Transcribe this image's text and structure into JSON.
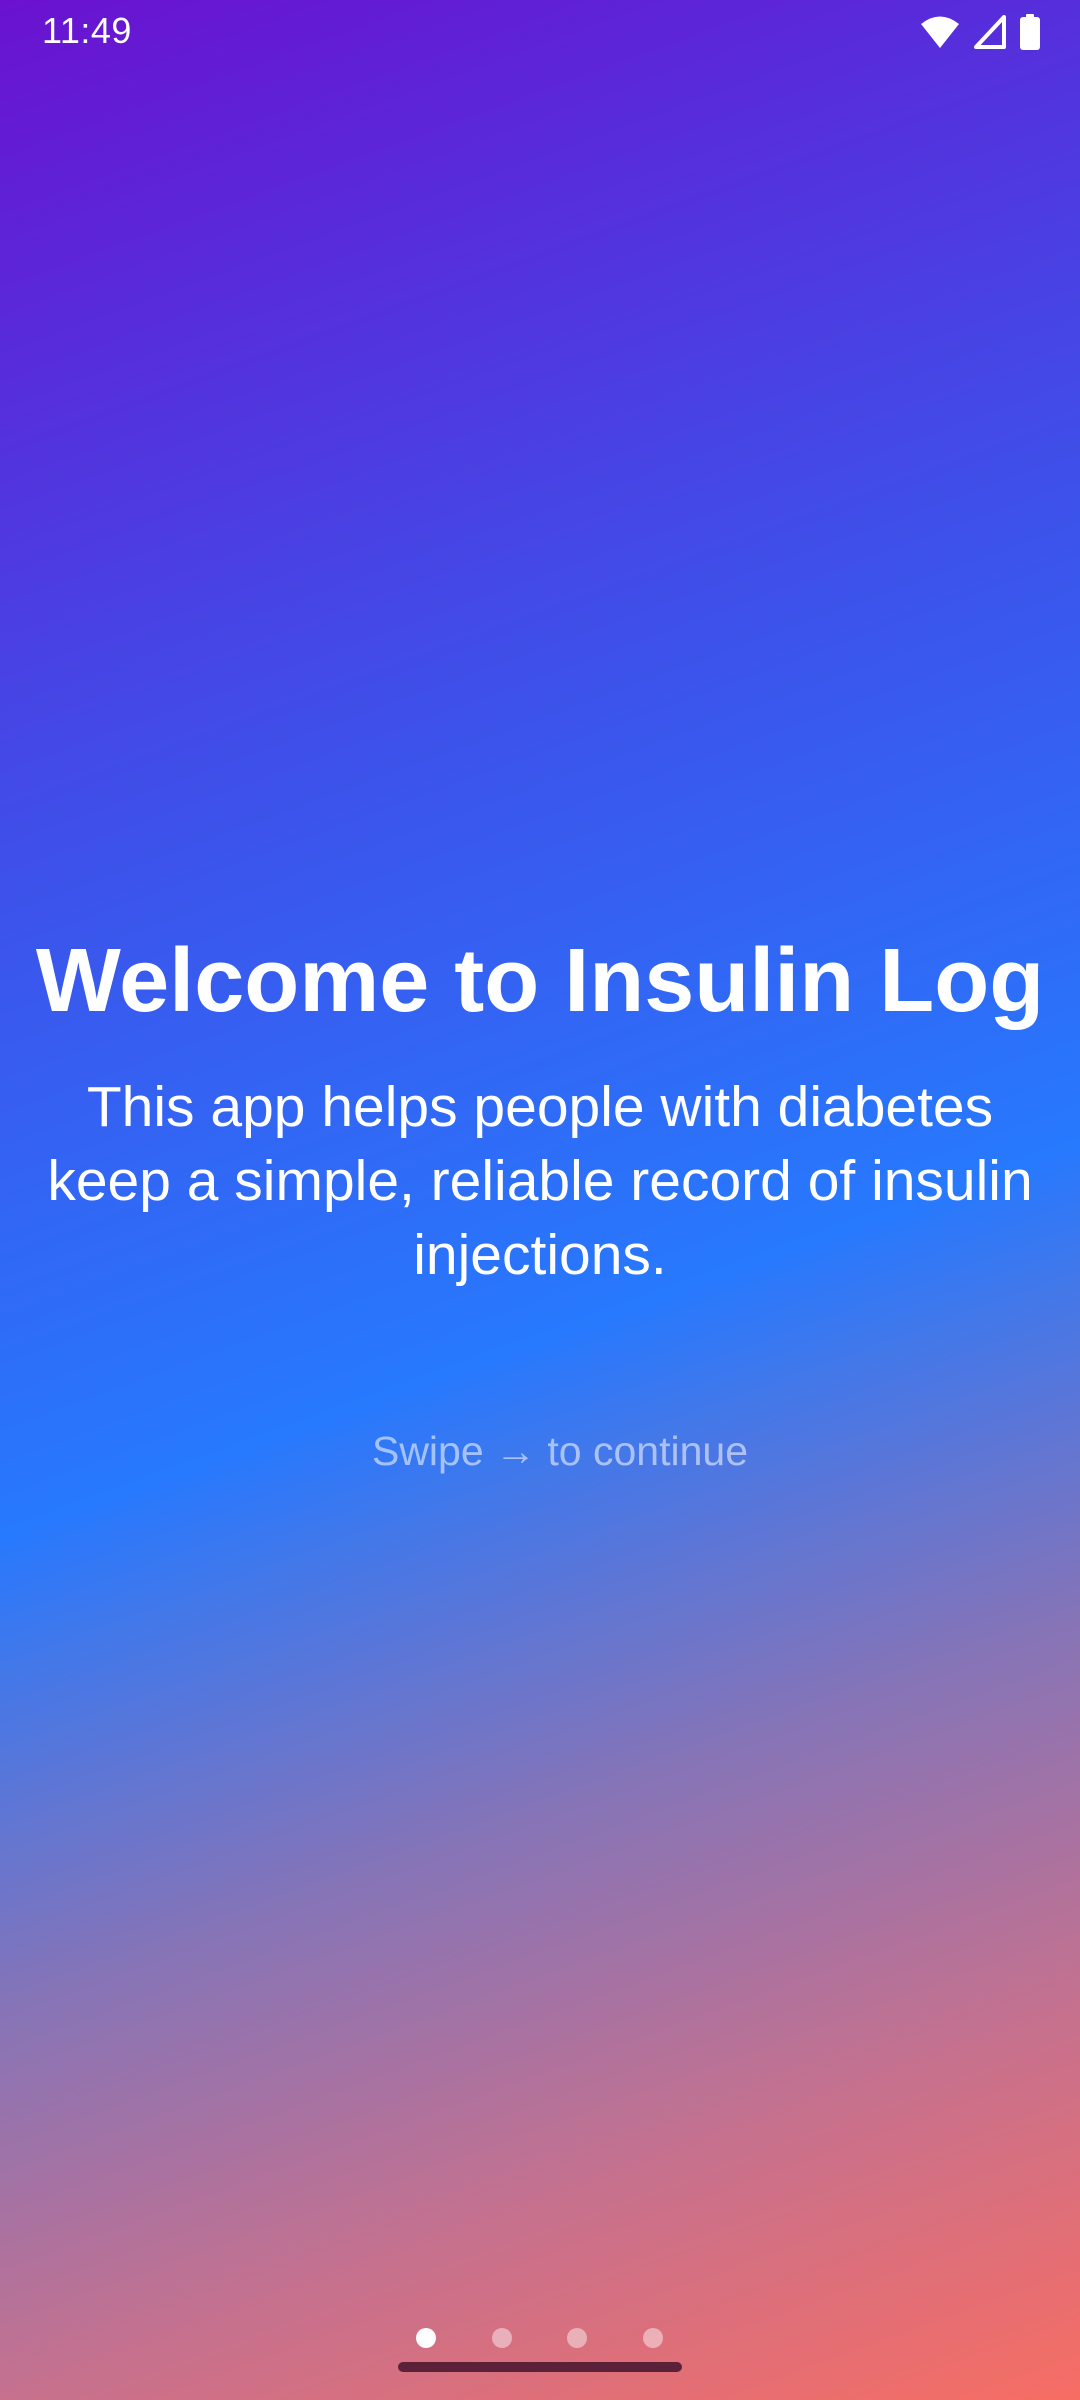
{
  "status_bar": {
    "time": "11:49",
    "icons": [
      "wifi-icon",
      "cellular-signal-icon",
      "battery-icon"
    ]
  },
  "onboarding": {
    "title": "Welcome to Insulin Log",
    "description": "This app helps people with diabetes keep a simple, reliable record of insulin injections.",
    "hint": "Swipe → to continue"
  },
  "pager": {
    "total_pages": 4,
    "current_page": 1
  },
  "colors": {
    "gradient_top": "#6a12d0",
    "gradient_mid": "#2779fe",
    "gradient_bottom": "#f76d63",
    "home_indicator": "#5b2138"
  }
}
